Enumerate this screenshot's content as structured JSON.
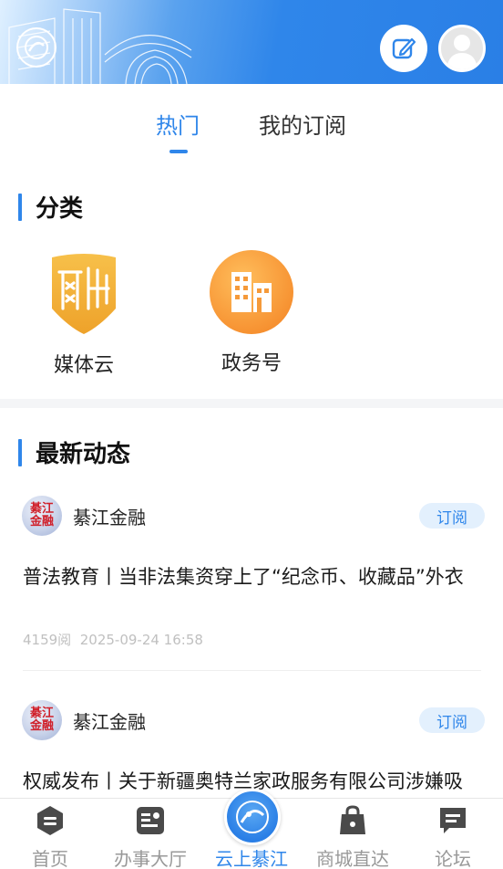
{
  "header": {
    "logo_icon": "qijiang-logo-icon",
    "edit_icon": "edit-icon",
    "avatar_icon": "user-avatar-icon",
    "colors": {
      "accent": "#2f86ea"
    }
  },
  "tabs": [
    {
      "label": "热门",
      "active": true
    },
    {
      "label": "我的订阅",
      "active": false
    }
  ],
  "categories": {
    "title": "分类",
    "items": [
      {
        "label": "媒体云",
        "icon": "media-cloud-icon"
      },
      {
        "label": "政务号",
        "icon": "government-building-icon"
      }
    ]
  },
  "latest": {
    "title": "最新动态",
    "items": [
      {
        "source": "綦江金融",
        "avatar_text": "綦江金融",
        "subscribe_label": "订阅",
        "title": "普法教育丨当非法集资穿上了“纪念币、收藏品”外衣",
        "reads": "4159阅",
        "time": "2025-09-24 16:58"
      },
      {
        "source": "綦江金融",
        "avatar_text": "綦江金融",
        "subscribe_label": "订阅",
        "title": "权威发布丨关于新疆奥特兰家政服务有限公司涉嫌吸"
      }
    ]
  },
  "bottom_nav": [
    {
      "label": "首页",
      "icon": "home-icon",
      "active": false
    },
    {
      "label": "办事大厅",
      "icon": "service-hall-icon",
      "active": false
    },
    {
      "label": "云上綦江",
      "icon": "cloud-qijiang-icon",
      "active": true
    },
    {
      "label": "商城直达",
      "icon": "shopping-bag-icon",
      "active": false
    },
    {
      "label": "论坛",
      "icon": "forum-icon",
      "active": false
    }
  ]
}
